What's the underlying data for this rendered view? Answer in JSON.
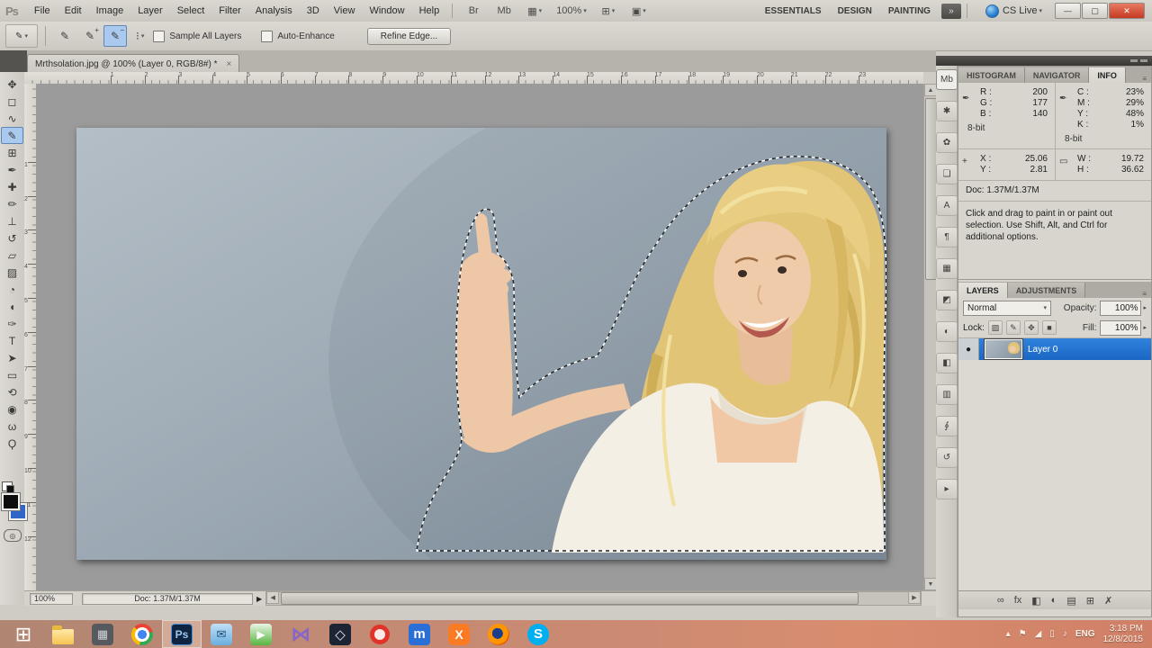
{
  "colors": {
    "accent_blue": "#1b66c4",
    "tool_highlight": "#a9c9ef",
    "close_red": "#c53a22",
    "taskbar_tint": "#cc8a72",
    "selection_ants": "#ffffff"
  },
  "menubar": {
    "logo": "Ps",
    "items": [
      "File",
      "Edit",
      "Image",
      "Layer",
      "Select",
      "Filter",
      "Analysis",
      "3D",
      "View",
      "Window",
      "Help"
    ],
    "icon_buttons": [
      {
        "name": "launch-bridge",
        "glyph": "Br"
      },
      {
        "name": "launch-mini-bridge",
        "glyph": "Mb"
      },
      {
        "name": "view-extras",
        "glyph": "▦",
        "dd": true
      },
      {
        "name": "zoom-level",
        "glyph": "100%",
        "dd": true
      },
      {
        "name": "arrange-documents",
        "glyph": "⊞",
        "dd": true
      },
      {
        "name": "screen-mode",
        "glyph": "▣",
        "dd": true
      }
    ],
    "workspaces": [
      {
        "label": "ESSENTIALS"
      },
      {
        "label": "DESIGN"
      },
      {
        "label": "PAINTING"
      }
    ],
    "overflow": "»",
    "cslive_label": "CS Live",
    "cslive_dd": "▾",
    "window_buttons": [
      {
        "name": "minimize",
        "glyph": "—"
      },
      {
        "name": "restore",
        "glyph": "▢"
      },
      {
        "name": "close",
        "glyph": "✕"
      }
    ]
  },
  "optionsbar": {
    "tool_glyph": "✎",
    "tool_dd": "▾",
    "modes": [
      {
        "name": "new-selection",
        "glyph": "✎",
        "sup": ""
      },
      {
        "name": "add-to-selection",
        "glyph": "✎",
        "sup": "+"
      },
      {
        "name": "subtract-from-selection",
        "glyph": "✎",
        "sup": "−",
        "selected": true
      }
    ],
    "brush_glyph": "⁝",
    "brush_dd": "▾",
    "checkboxes": [
      {
        "label": "Sample All Layers",
        "checked": false
      },
      {
        "label": "Auto-Enhance",
        "checked": false
      }
    ],
    "refine_button": "Refine Edge..."
  },
  "doctab": {
    "title": "Mrthsolation.jpg @ 100% (Layer 0, RGB/8#) *",
    "close": "×"
  },
  "tools": [
    {
      "name": "move",
      "glyph": "✥"
    },
    {
      "name": "rectangular-marquee",
      "glyph": "◻"
    },
    {
      "name": "lasso",
      "glyph": "∿"
    },
    {
      "name": "quick-selection",
      "glyph": "✎",
      "selected": true
    },
    {
      "name": "crop",
      "glyph": "⊞"
    },
    {
      "name": "eyedropper",
      "glyph": "✒"
    },
    {
      "name": "spot-healing-brush",
      "glyph": "✚"
    },
    {
      "name": "brush",
      "glyph": "✏"
    },
    {
      "name": "clone-stamp",
      "glyph": "⊥"
    },
    {
      "name": "history-brush",
      "glyph": "↺"
    },
    {
      "name": "eraser",
      "glyph": "▱"
    },
    {
      "name": "gradient",
      "glyph": "▨"
    },
    {
      "name": "blur",
      "glyph": "◔"
    },
    {
      "name": "dodge",
      "glyph": "◖"
    },
    {
      "name": "pen",
      "glyph": "✑"
    },
    {
      "name": "type",
      "glyph": "T"
    },
    {
      "name": "path-selection",
      "glyph": "➤"
    },
    {
      "name": "rectangle",
      "glyph": "▭"
    },
    {
      "name": "3d-object-rotate",
      "glyph": "⟲"
    },
    {
      "name": "3d-camera-rotate",
      "glyph": "◉"
    },
    {
      "name": "hand",
      "glyph": "ω"
    },
    {
      "name": "zoom",
      "glyph": "Ϙ"
    }
  ],
  "rulers": {
    "h_labels": [
      "1",
      "2",
      "3",
      "4",
      "5",
      "6",
      "7",
      "8",
      "9",
      "10",
      "11",
      "12",
      "13",
      "14",
      "15",
      "16",
      "17",
      "18",
      "19",
      "20",
      "21",
      "22",
      "23"
    ],
    "v_labels": [
      "1",
      "2",
      "3",
      "4",
      "5",
      "6",
      "7",
      "8",
      "9",
      "10",
      "11",
      "12"
    ]
  },
  "dock_icons": [
    {
      "name": "mini-bridge-panel",
      "glyph": "Mb"
    },
    {
      "name": "tool-presets-panel",
      "glyph": "✱"
    },
    {
      "name": "brushes-panel",
      "glyph": "✿"
    },
    {
      "name": "clone-source-panel",
      "glyph": "❏"
    },
    {
      "name": "character-panel",
      "glyph": "A"
    },
    {
      "name": "paragraph-panel",
      "glyph": "¶"
    },
    {
      "name": "swatches-panel",
      "glyph": "▦"
    },
    {
      "name": "styles-panel",
      "glyph": "◩"
    },
    {
      "name": "adjustments-panel",
      "glyph": "◐"
    },
    {
      "name": "masks-panel",
      "glyph": "◧"
    },
    {
      "name": "channels-panel",
      "glyph": "▥"
    },
    {
      "name": "paths-panel",
      "glyph": "∮"
    },
    {
      "name": "history-panel",
      "glyph": "↺"
    },
    {
      "name": "actions-panel",
      "glyph": "▸"
    }
  ],
  "info_panel": {
    "tabs": [
      {
        "label": "HISTOGRAM"
      },
      {
        "label": "NAVIGATOR"
      },
      {
        "label": "INFO",
        "active": true
      }
    ],
    "rgb": {
      "icon": "✒",
      "r_label": "R :",
      "r": "200",
      "g_label": "G :",
      "g": "177",
      "b_label": "B :",
      "b": "140",
      "bit": "8-bit"
    },
    "cmyk": {
      "icon": "✒",
      "c_label": "C :",
      "c": "23%",
      "m_label": "M :",
      "m": "29%",
      "y_label": "Y :",
      "y": "48%",
      "k_label": "K :",
      "k": "1%",
      "bit": "8-bit"
    },
    "xy": {
      "icon": "+",
      "x_label": "X :",
      "x": "25.06",
      "y_label": "Y :",
      "y": "2.81"
    },
    "wh": {
      "icon": "▭",
      "w_label": "W :",
      "w": "19.72",
      "h_label": "H :",
      "h": "36.62"
    },
    "doc": "Doc: 1.37M/1.37M",
    "hint": "Click and drag to paint in or paint out selection.  Use Shift, Alt, and Ctrl for additional options."
  },
  "layers_panel": {
    "tabs": [
      {
        "label": "LAYERS",
        "active": true
      },
      {
        "label": "ADJUSTMENTS"
      }
    ],
    "blend_mode": "Normal",
    "blend_dd": "▾",
    "opacity_label": "Opacity:",
    "opacity": "100%",
    "lock_label": "Lock:",
    "lock_icons": [
      {
        "name": "lock-transparent-pixels",
        "glyph": "▨"
      },
      {
        "name": "lock-image-pixels",
        "glyph": "✎"
      },
      {
        "name": "lock-position",
        "glyph": "✥"
      },
      {
        "name": "lock-all",
        "glyph": "■"
      }
    ],
    "fill_label": "Fill:",
    "fill": "100%",
    "layers": [
      {
        "name": "Layer 0",
        "eye": "●",
        "visible": true,
        "selected": true
      }
    ],
    "bottom_icons": [
      {
        "name": "link-layers",
        "glyph": "∞"
      },
      {
        "name": "layer-style",
        "glyph": "fx"
      },
      {
        "name": "add-layer-mask",
        "glyph": "◧"
      },
      {
        "name": "new-adjustment-layer",
        "glyph": "◐"
      },
      {
        "name": "new-group",
        "glyph": "▤"
      },
      {
        "name": "new-layer",
        "glyph": "⊞"
      },
      {
        "name": "delete-layer",
        "glyph": "✗"
      }
    ]
  },
  "statusbar": {
    "zoom": "100%",
    "doc": "Doc: 1.37M/1.37M",
    "menu_arrow": "▶"
  },
  "taskbar": {
    "apps": [
      {
        "name": "start",
        "glyph": "⊞"
      },
      {
        "name": "explorer",
        "glyph": ""
      },
      {
        "name": "app-grid",
        "glyph": "▦"
      },
      {
        "name": "chrome",
        "glyph": ""
      },
      {
        "name": "photoshop",
        "glyph": "Ps",
        "active": true
      },
      {
        "name": "mail-app",
        "glyph": "✉"
      },
      {
        "name": "media-app",
        "glyph": "▶"
      },
      {
        "name": "kmplayer",
        "glyph": "⋈"
      },
      {
        "name": "cube-app",
        "glyph": "◇"
      },
      {
        "name": "opera",
        "glyph": ""
      },
      {
        "name": "maxthon",
        "glyph": "m"
      },
      {
        "name": "xampp",
        "glyph": "X"
      },
      {
        "name": "firefox",
        "glyph": ""
      },
      {
        "name": "skype",
        "glyph": "S"
      }
    ],
    "tray": [
      {
        "name": "show-hidden-icons",
        "glyph": "▴"
      },
      {
        "name": "action-center",
        "glyph": "⚑"
      },
      {
        "name": "network",
        "glyph": "◢"
      },
      {
        "name": "pc-status",
        "glyph": "▯"
      },
      {
        "name": "volume",
        "glyph": "♪"
      }
    ],
    "lang": "ENG",
    "time": "3:18 PM",
    "date": "12/8/2015"
  }
}
